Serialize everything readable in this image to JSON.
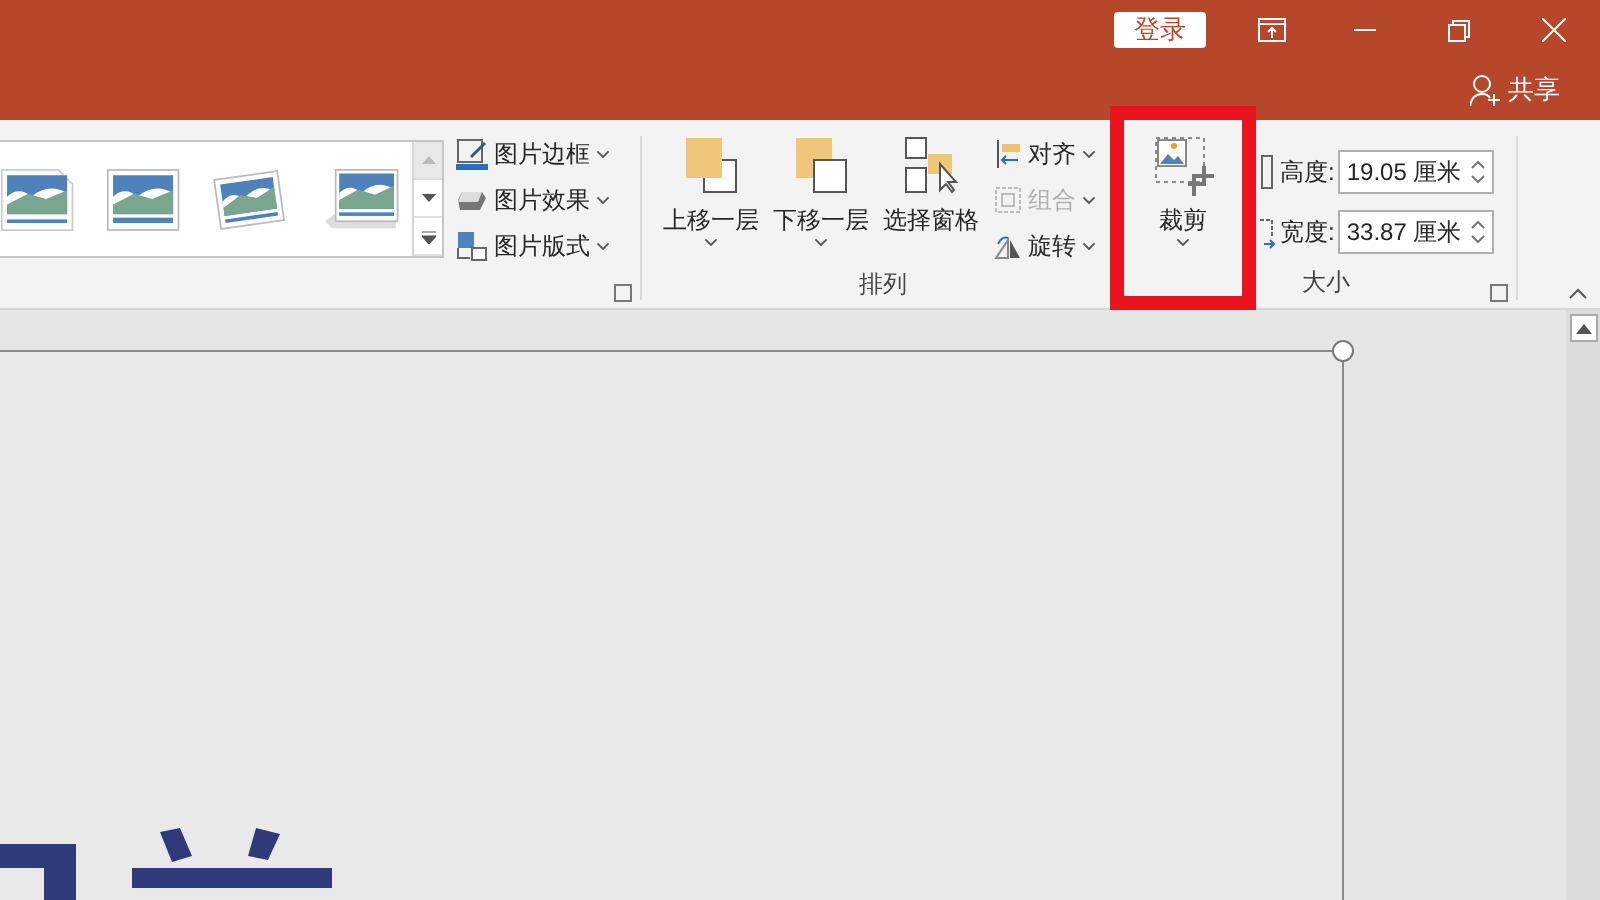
{
  "title_bar": {
    "login_button": "登录",
    "share_button": "共享"
  },
  "ribbon": {
    "picture_styles": [
      {
        "kind": "snipped"
      },
      {
        "kind": "plain"
      },
      {
        "kind": "tilted"
      },
      {
        "kind": "shadow"
      }
    ],
    "picture_commands": [
      {
        "kind": "border",
        "label": "图片边框"
      },
      {
        "kind": "effects",
        "label": "图片效果"
      },
      {
        "kind": "layout",
        "label": "图片版式"
      }
    ],
    "arrange": {
      "label": "排列",
      "large_buttons": [
        {
          "kind": "forward",
          "label": "上移一层",
          "dropdown": true
        },
        {
          "kind": "backward",
          "label": "下移一层",
          "dropdown": true
        },
        {
          "kind": "pane",
          "label": "选择窗格",
          "dropdown": false
        }
      ],
      "small_buttons": [
        {
          "kind": "align",
          "label": "对齐",
          "disabled": false
        },
        {
          "kind": "group",
          "label": "组合",
          "disabled": true
        },
        {
          "kind": "rotate",
          "label": "旋转",
          "disabled": false
        }
      ]
    },
    "crop_button": {
      "label": "裁剪",
      "highlighted": true
    },
    "size": {
      "label": "大小",
      "fields": [
        {
          "kind": "height",
          "label": "高度:",
          "value": "19.05 厘米"
        },
        {
          "kind": "width",
          "label": "宽度:",
          "value": "33.87 厘米"
        }
      ]
    }
  }
}
